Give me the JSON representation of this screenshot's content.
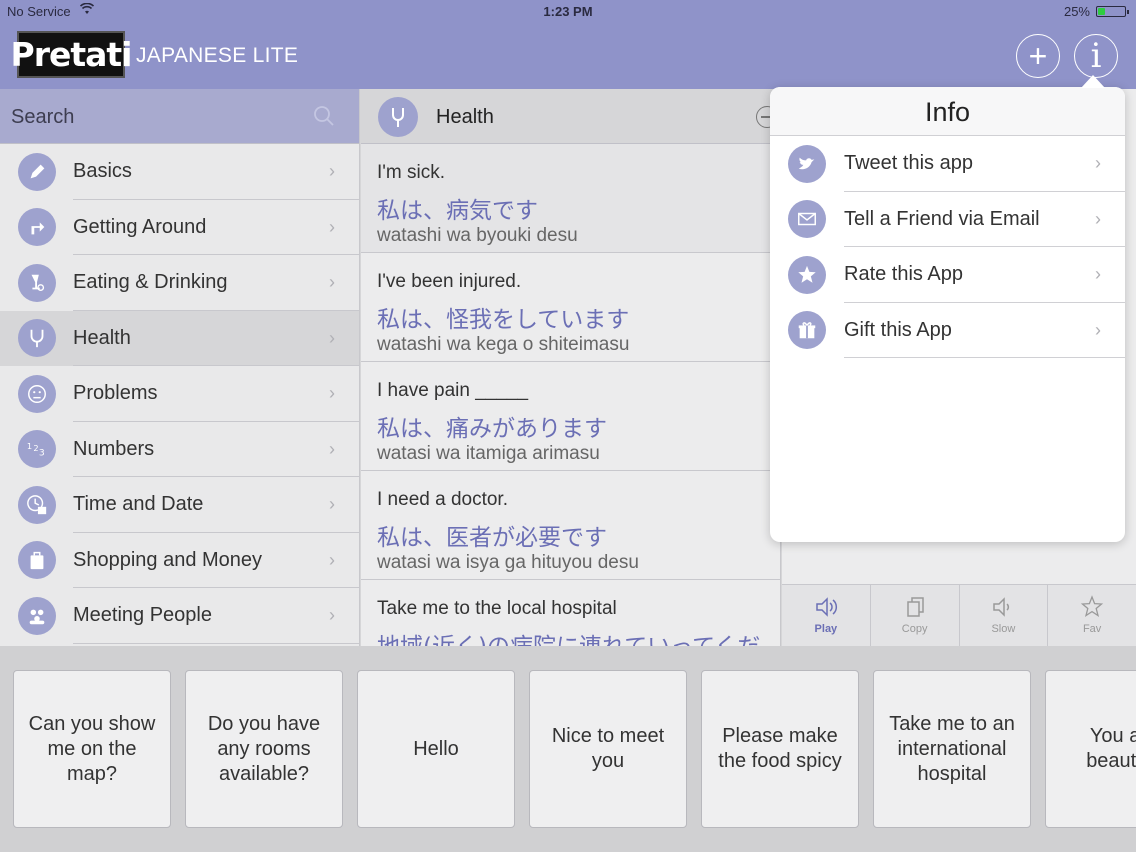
{
  "status_bar": {
    "carrier": "No Service",
    "time": "1:23 PM",
    "battery_pct": "25%",
    "battery_level": 0.25
  },
  "header": {
    "logo": "Pretati",
    "subtitle": "JAPANESE LITE"
  },
  "search": {
    "label": "Search"
  },
  "categories": [
    {
      "label": "Basics",
      "icon": "pencil-icon"
    },
    {
      "label": "Getting Around",
      "icon": "turn-arrow-icon"
    },
    {
      "label": "Eating & Drinking",
      "icon": "glass-fork-icon"
    },
    {
      "label": "Health",
      "icon": "stethoscope-icon",
      "selected": true
    },
    {
      "label": "Problems",
      "icon": "sad-face-icon"
    },
    {
      "label": "Numbers",
      "icon": "numbers-icon"
    },
    {
      "label": "Time and Date",
      "icon": "clock-calendar-icon"
    },
    {
      "label": "Shopping and Money",
      "icon": "shopping-bag-icon"
    },
    {
      "label": "Meeting People",
      "icon": "people-icon"
    }
  ],
  "phrase_panel": {
    "title": "Health",
    "phrases": [
      {
        "en": "I'm sick.",
        "ja": "私は、病気です",
        "romaji": "watashi wa byouki desu"
      },
      {
        "en": "I've been injured.",
        "ja": "私は、怪我をしています",
        "romaji": "watashi wa kega o shiteimasu"
      },
      {
        "en": "I have pain _____",
        "ja": "私は、痛みがあります",
        "romaji": "watasi wa itamiga arimasu"
      },
      {
        "en": "I need a doctor.",
        "ja": "私は、医者が必要です",
        "romaji": "watasi wa isya ga hituyou desu"
      },
      {
        "en": "Take me to the local hospital",
        "ja": "地域(近く)の病院に連れていってください",
        "romaji": ""
      }
    ]
  },
  "toolbar": [
    {
      "label": "Play",
      "icon": "speaker-icon",
      "active": true
    },
    {
      "label": "Copy",
      "icon": "copy-icon",
      "active": false
    },
    {
      "label": "Slow",
      "icon": "speaker-slow-icon",
      "active": false
    },
    {
      "label": "Fav",
      "icon": "star-outline-icon",
      "active": false
    }
  ],
  "info_popover": {
    "title": "Info",
    "items": [
      {
        "label": "Tweet this app",
        "icon": "twitter-bird-icon"
      },
      {
        "label": "Tell a Friend via Email",
        "icon": "envelope-icon"
      },
      {
        "label": "Rate this App",
        "icon": "star-icon"
      },
      {
        "label": "Gift this App",
        "icon": "gift-icon"
      }
    ]
  },
  "quick_phrases": [
    "Can you show me on the map?",
    "Do you have any rooms available?",
    "Hello",
    "Nice to meet you",
    "Please make the food spicy",
    "Take me to an international hospital",
    "You are beautiful"
  ],
  "colors": {
    "accent": "#8f93c9",
    "icon_bg": "#9ea2ce",
    "japanese_text": "#6b6fb5"
  }
}
